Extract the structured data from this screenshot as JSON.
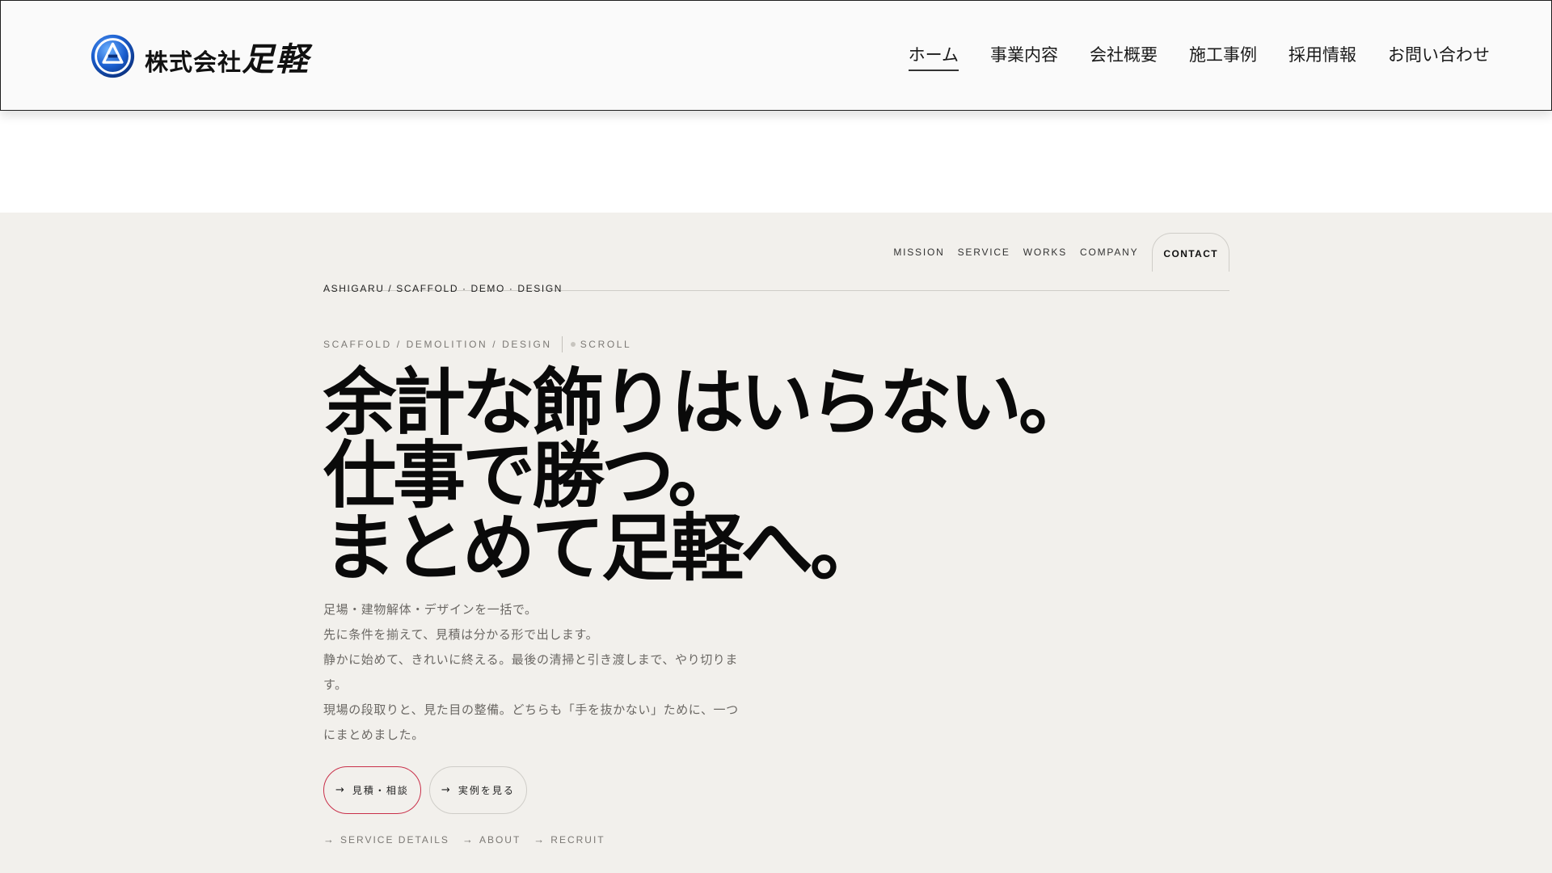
{
  "header": {
    "logo_text": "株式会社",
    "logo_text_big": "足軽",
    "nav": [
      {
        "label": "ホーム",
        "active": true
      },
      {
        "label": "事業内容",
        "active": false
      },
      {
        "label": "会社概要",
        "active": false
      },
      {
        "label": "施工事例",
        "active": false
      },
      {
        "label": "採用情報",
        "active": false
      },
      {
        "label": "お問い合わせ",
        "active": false
      }
    ]
  },
  "hero": {
    "brand_line": "ASHIGARU / SCAFFOLD · DEMO · DESIGN",
    "sub_nav": [
      "MISSION",
      "SERVICE",
      "WORKS",
      "COMPANY"
    ],
    "contact_label": "CONTACT",
    "tagline": "SCAFFOLD / DEMOLITION / DESIGN",
    "scroll_label": "SCROLL",
    "headline": [
      "余計な飾りはいらない。",
      "仕事で勝つ。",
      "まとめて足軽へ。"
    ],
    "lead": [
      "足場・建物解体・デザインを一括で。",
      "先に条件を揃えて、見積は分かる形で出します。",
      "静かに始めて、きれいに終える。最後の清掃と引き渡しまで、やり切ります。",
      "現場の段取りと、見た目の整備。どちらも「手を抜かない」ために、一つにまとめました。"
    ],
    "cta_primary": "見積・相談",
    "cta_secondary": "実例を見る",
    "links": [
      "SERVICE DETAILS",
      "ABOUT",
      "RECRUIT"
    ],
    "arrow_glyph": "→"
  },
  "colors": {
    "hero_bg": "#f2f0ec",
    "accent": "#c9304a",
    "logo_blue": "#1b5fd0"
  }
}
